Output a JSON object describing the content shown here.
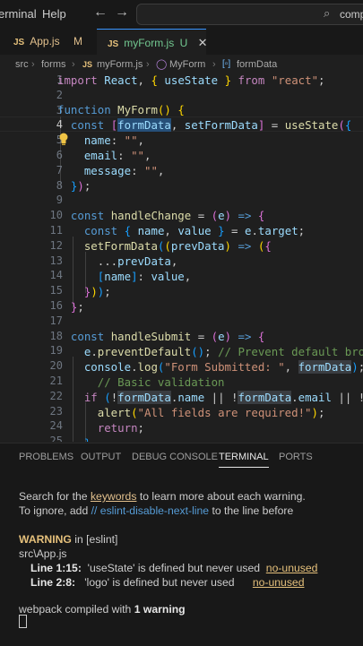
{
  "titlebar": {
    "menu_terminal": "erminal",
    "menu_help": "Help",
    "back_icon": "arrow-left-icon",
    "forward_icon": "arrow-right-icon",
    "search_text": "comp"
  },
  "tabs": [
    {
      "type": "JS",
      "label": "App.js",
      "status": "M"
    },
    {
      "type": "JS",
      "label": "myForm.js",
      "status": "U"
    }
  ],
  "breadcrumb": [
    "src",
    "forms",
    "myForm.js",
    "MyForm",
    "formData"
  ],
  "editor": {
    "line_numbers": [
      "1",
      "2",
      "3",
      "4",
      "5",
      "6",
      "7",
      "8",
      "9",
      "10",
      "11",
      "12",
      "13",
      "14",
      "15",
      "16",
      "17",
      "18",
      "19",
      "20",
      "21",
      "22",
      "23",
      "24",
      "25"
    ],
    "active_line": "4",
    "lines": [
      "import React, { useState } from \"react\";",
      "",
      "function MyForm() {",
      "  const [formData, setFormData] = useState({",
      "    name: \"\",",
      "    email: \"\",",
      "    message: \"\",",
      "  });",
      "",
      "  const handleChange = (e) => {",
      "    const { name, value } = e.target;",
      "    setFormData((prevData) => ({",
      "      ...prevData,",
      "      [name]: value,",
      "    }));",
      "  };",
      "",
      "  const handleSubmit = (e) => {",
      "    e.preventDefault(); // Prevent default browser",
      "    console.log(\"Form Submitted: \", formData);",
      "      // Basic validation",
      "    if (!formData.name || !formData.email || !formD",
      "      alert(\"All fields are required!\");",
      "      return;",
      "    }"
    ]
  },
  "panel": {
    "tabs": [
      "PROBLEMS",
      "OUTPUT",
      "DEBUG CONSOLE",
      "TERMINAL",
      "PORTS"
    ],
    "active_tab": "TERMINAL",
    "terminal": {
      "line1_pre": "Search for the ",
      "line1_link": "keywords",
      "line1_post": " to learn more about each warning.",
      "line2_pre": "To ignore, add ",
      "line2_code": "// eslint-disable-next-line",
      "line2_post": " to the line before",
      "warning_label": "WARNING",
      "warning_rest": " in [eslint]",
      "file": "src\\App.js",
      "w1_loc": "Line 1:15:",
      "w1_msg": "  'useState' is defined but never used  ",
      "w1_rule": "no-unused",
      "w2_loc": "Line 2:8:",
      "w2_msg": "   'logo' is defined but never used      ",
      "w2_rule": "no-unused",
      "compiled_pre": "webpack compiled with ",
      "compiled_bold": "1 warning"
    }
  }
}
